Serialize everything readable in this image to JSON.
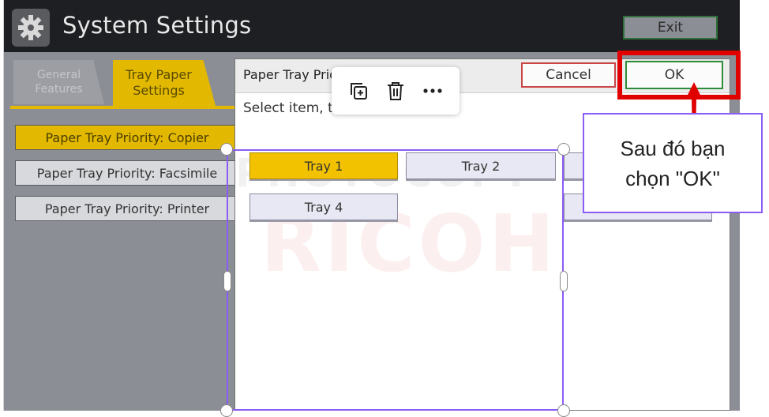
{
  "window": {
    "title": "System Settings",
    "exit_label": "Exit"
  },
  "tabs": [
    {
      "line1": "General",
      "line2": "Features",
      "active": false
    },
    {
      "line1": "Tray Paper",
      "line2": "Settings",
      "active": true
    }
  ],
  "sidebar": {
    "items": [
      {
        "label": "Paper Tray Priority: Copier",
        "active": true
      },
      {
        "label": "Paper Tray Priority: Facsimile",
        "active": false
      },
      {
        "label": "Paper Tray Priority: Printer",
        "active": false
      }
    ]
  },
  "dialog": {
    "title": "Paper Tray Prio",
    "cancel_label": "Cancel",
    "ok_label": "OK",
    "instruction": "Select item, t"
  },
  "trays": [
    {
      "label": "Tray 1",
      "active": true
    },
    {
      "label": "Tray 2",
      "active": false
    },
    {
      "label": "Tray 4",
      "active": false
    }
  ],
  "watermark": {
    "line1": "PHOTOCOPY",
    "line2": "RICOH"
  },
  "annotation": {
    "line1": "Sau đó bạn",
    "line2": "chọn \"OK\""
  },
  "editor_toolbar": {
    "icons": [
      "duplicate-icon",
      "trash-icon",
      "more-icon"
    ]
  },
  "colors": {
    "accent_yellow": "#e2b900",
    "highlight_red": "#e00000",
    "selection_purple": "#8b5cf6",
    "ok_green": "#2f8c3a",
    "cancel_red": "#c84545"
  }
}
